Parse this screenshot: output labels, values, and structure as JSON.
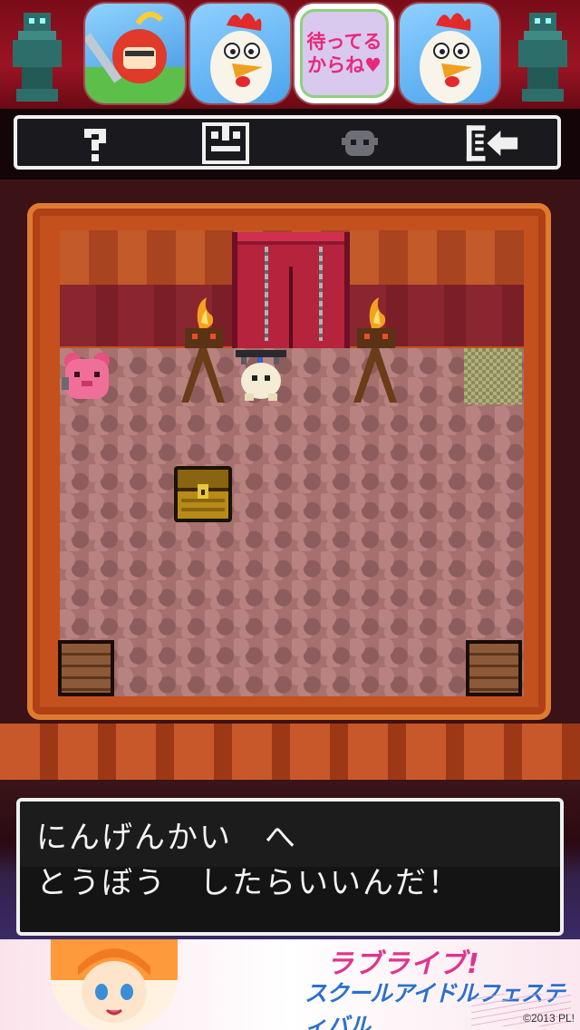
{
  "ad_top": {
    "icons": [
      {
        "name": "knight-game-app-icon"
      },
      {
        "name": "chicken-game-app-icon"
      },
      {
        "name": "matteru-karane-app-icon",
        "label": "待ってる\nからね♥"
      },
      {
        "name": "chicken-game-app-icon-2"
      }
    ],
    "colors": {
      "band": "#8a0f1e",
      "statue": "#2e6e6a"
    }
  },
  "toolbar": {
    "buttons": [
      {
        "name": "help-button",
        "icon": "question-mark-icon"
      },
      {
        "name": "inventory-button",
        "icon": "box-menu-icon"
      },
      {
        "name": "character-button",
        "icon": "ghost-face-icon"
      },
      {
        "name": "exit-button",
        "icon": "arrow-exit-icon"
      }
    ]
  },
  "board": {
    "objects": [
      "iron-gate",
      "torch-left",
      "torch-right",
      "hero-sprite",
      "pink-bear-sprite",
      "exit-tile",
      "treasure-chest",
      "crate-left",
      "crate-right"
    ]
  },
  "dialogue": {
    "line1": "にんげんかい　へ",
    "line2": "とうぼう　したらいいんだ！"
  },
  "ad_bottom": {
    "title_line1": "ラブライブ!",
    "title_line2": "スクールアイドルフェスティバル",
    "copyright": "©2013 PL!"
  }
}
